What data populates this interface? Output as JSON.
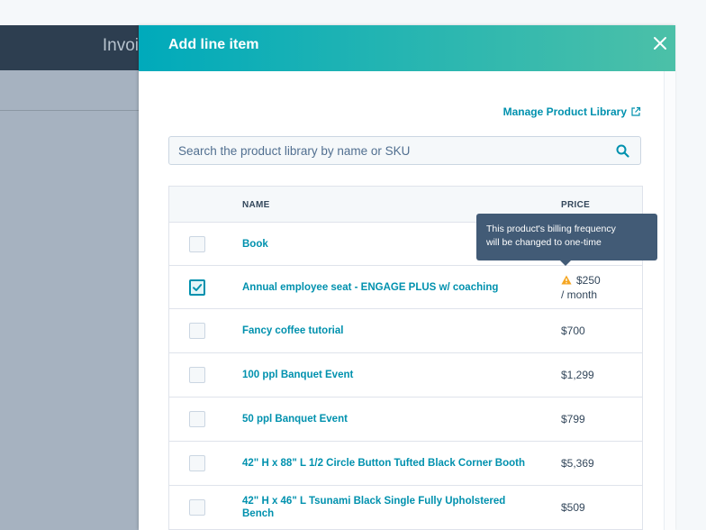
{
  "background": {
    "title": "Invoi"
  },
  "panel": {
    "title": "Add line item",
    "manage_link": "Manage Product Library",
    "search_placeholder": "Search the product library by name or SKU",
    "colors": {
      "header_start": "#00aabb",
      "header_end": "#4cc0a8",
      "link": "#0091ae",
      "warning": "#f5a623"
    }
  },
  "table": {
    "headers": {
      "name": "NAME",
      "price": "PRICE"
    },
    "rows": [
      {
        "name": "Book",
        "price": "",
        "checked": false
      },
      {
        "name": "Annual employee seat - ENGAGE PLUS w/ coaching",
        "price": "$250",
        "price_period": "/ month",
        "checked": true,
        "warning": true
      },
      {
        "name": "Fancy coffee tutorial",
        "price": "$700",
        "checked": false
      },
      {
        "name": "100 ppl Banquet Event",
        "price": "$1,299",
        "checked": false
      },
      {
        "name": "50 ppl Banquet Event",
        "price": "$799",
        "checked": false
      },
      {
        "name": "42\" H x 88\" L 1/2 Circle Button Tufted Black Corner Booth",
        "price": "$5,369",
        "checked": false
      },
      {
        "name": "42\" H x 46\" L Tsunami Black Single Fully Upholstered Bench",
        "price": "$509",
        "checked": false
      }
    ]
  },
  "tooltip": {
    "line1": "This product's billing frequency",
    "line2": "will be changed to one-time"
  }
}
